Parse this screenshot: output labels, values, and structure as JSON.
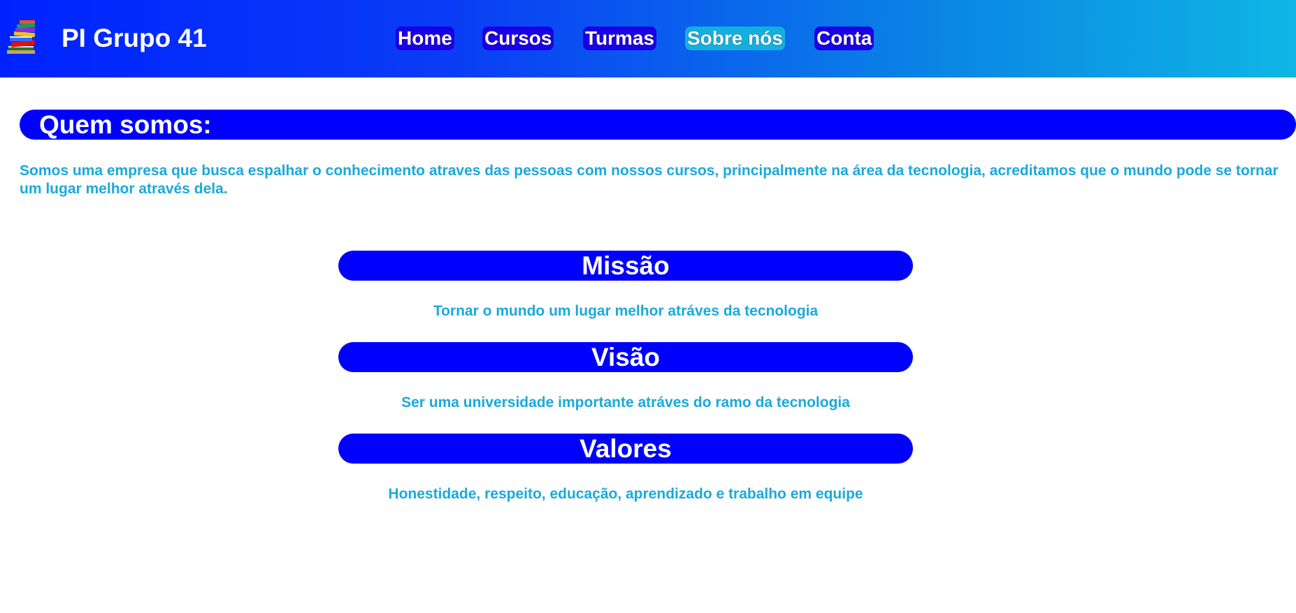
{
  "header": {
    "brand": "PI Grupo 41",
    "logo_icon": "books-stack-icon",
    "nav": [
      {
        "label": "Home"
      },
      {
        "label": "Cursos"
      },
      {
        "label": "Turmas"
      },
      {
        "label": "Sobre nós",
        "active": true
      },
      {
        "label": "Conta"
      }
    ],
    "gradient_colors": [
      "#0022ff",
      "#0fb6e5"
    ]
  },
  "about": {
    "heading": "Quem somos:",
    "text": "Somos uma empresa que busca espalhar o conhecimento atraves das pessoas com nossos cursos, principalmente na área da tecnologia, acreditamos que o mundo pode se tornar um lugar melhor através dela."
  },
  "sections": [
    {
      "title": "Missão",
      "text": "Tornar o mundo um lugar melhor atráves da tecnologia"
    },
    {
      "title": "Visão",
      "text": "Ser uma universidade importante atráves do ramo da tecnologia"
    },
    {
      "title": "Valores",
      "text": "Honestidade, respeito, educação, aprendizado e trabalho em equipe"
    }
  ],
  "colors": {
    "bar": "#0000ff",
    "text_accent": "#1aa9dc",
    "nav_bg": "#1a00e6",
    "nav_active_bg": "#13b0df"
  }
}
